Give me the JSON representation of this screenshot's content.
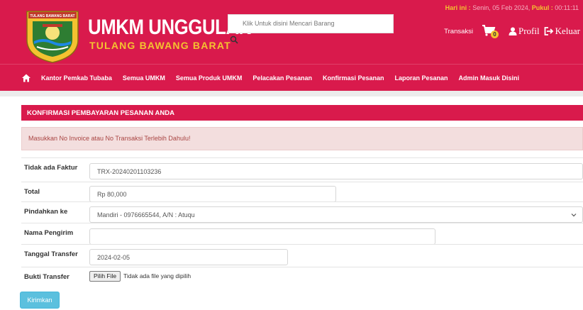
{
  "header": {
    "logo_banner": "TULANG BAWANG BARAT",
    "brand_title": "UMKM UNGGULAN",
    "brand_subtitle": "TULANG BAWANG BARAT",
    "search_placeholder": "Klik Untuk disini Mencari Barang",
    "date_label": "Hari ini :",
    "date_value": "Senin, 05 Feb 2024,",
    "time_label": "Pukul :",
    "time_value": "00:11:11",
    "transaksi_label": "Transaksi",
    "cart_count": "0",
    "profil_label": "Profil",
    "keluar_label": "Keluar",
    "brand_color": "#d91a4c",
    "accent_color": "#f4c230"
  },
  "nav": {
    "home_icon": "home-icon",
    "items": [
      "Kantor Pemkab Tubaba",
      "Semua UMKM",
      "Semua Produk UMKM",
      "Pelacakan Pesanan",
      "Konfirmasi Pesanan",
      "Laporan Pesanan",
      "Admin Masuk Disini"
    ]
  },
  "panel": {
    "title": "KONFIRMASI PEMBAYARAN PESANAN ANDA",
    "alert": "Masukkan No Invoice atau No Transaksi Terlebih Dahulu!"
  },
  "form": {
    "faktur_label": "Tidak ada Faktur",
    "faktur_value": "TRX-20240201103236",
    "total_label": "Total",
    "total_value": "Rp 80,000",
    "pindahkan_label": "Pindahkan ke",
    "pindahkan_value": "Mandiri - 0976665544, A/N : Atuqu",
    "pengirim_label": "Nama Pengirim",
    "pengirim_value": "",
    "tanggal_label": "Tanggal Transfer",
    "tanggal_value": "2024-02-05",
    "bukti_label": "Bukti Transfer",
    "file_button": "Pilih File",
    "file_status": "Tidak ada file yang dipilih",
    "submit_label": "Kirimkan"
  }
}
